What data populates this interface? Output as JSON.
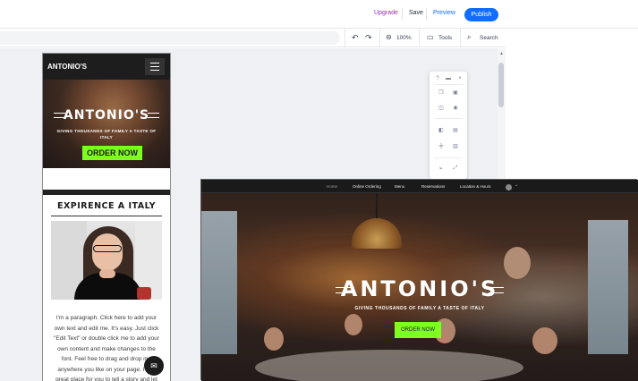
{
  "topbar": {
    "upgrade": "Upgrade",
    "save": "Save",
    "preview": "Preview",
    "publish": "Publish"
  },
  "subbar": {
    "undo_icon": "undo-icon",
    "redo_icon": "redo-icon",
    "zoom": "100%",
    "tools": "Tools",
    "search": "Search"
  },
  "mobile": {
    "logo": "ANTONIO'S",
    "hero_title": "ANTONIO'S",
    "hero_subtitle": "GIVING THOUSANDS OF FAMILY A TASTE OF ITALY",
    "order_button": "ORDER NOW",
    "section_title": "EXPIRENCE A ITALY",
    "paragraph": "I'm a paragraph. Click here to add your own text and edit me. It's easy. Just click \"Edit Text\" or double click me to add your own content and make changes to the font. Feel free to drag and drop me anywhere you like on your page. I'm a great place for you to tell a story and let your users know a little more"
  },
  "desktop": {
    "nav": [
      "Home",
      "Online Ordering",
      "Menu",
      "Reservations",
      "Location & Hours"
    ],
    "hero_title": "ANTONIO'S",
    "hero_subtitle": "GIVING THOUSANDS OF FAMILY A TASTE OF ITALY",
    "order_button": "ORDER NOW"
  },
  "colors": {
    "accent": "#116dff",
    "upgrade": "#9a27d5",
    "order_button": "#7fff20",
    "header_dark": "#1d1d1d"
  }
}
